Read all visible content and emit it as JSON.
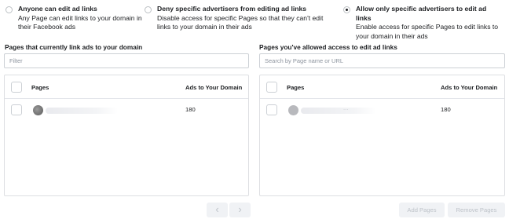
{
  "options": [
    {
      "title": "Anyone can edit ad links",
      "description": "Any Page can edit links to your domain in their Facebook ads",
      "checked": false
    },
    {
      "title": "Deny specific advertisers from editing ad links",
      "description": "Disable access for specific Pages so that they can't edit links to your domain in their ads",
      "checked": false
    },
    {
      "title": "Allow only specific advertisers to edit ad links",
      "description": "Enable access for specific Pages to edit links to your domain in their ads",
      "checked": true
    }
  ],
  "left_panel": {
    "title": "Pages that currently link ads to your domain",
    "search_placeholder": "Filter",
    "columns": [
      "Pages",
      "Ads to Your Domain"
    ],
    "rows": [
      {
        "page": "",
        "ads": "180"
      }
    ]
  },
  "right_panel": {
    "title": "Pages you've allowed access to edit ad links",
    "search_placeholder": "Search by Page name or URL",
    "columns": [
      "Pages",
      "Ads to Your Domain"
    ],
    "rows": [
      {
        "page": "...",
        "ads": "180"
      }
    ]
  },
  "pagination": {
    "prev_icon": "chevron-left-icon",
    "next_icon": "chevron-right-icon",
    "prev_glyph": "‹",
    "next_glyph": "›"
  },
  "actions": {
    "add_label": "Add Pages",
    "remove_label": "Remove Pages"
  }
}
